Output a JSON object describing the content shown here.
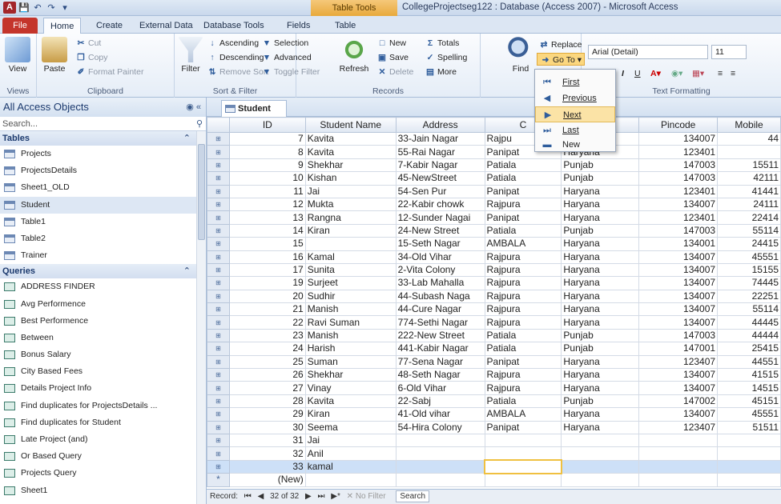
{
  "window": {
    "title": "CollegeProjectseg122 : Database (Access 2007) - Microsoft Access",
    "context_tab": "Table Tools",
    "app_icon": "A"
  },
  "tabs": [
    "File",
    "Home",
    "Create",
    "External Data",
    "Database Tools",
    "Fields",
    "Table"
  ],
  "ribbon": {
    "views": {
      "button": "View",
      "label": "Views"
    },
    "clipboard": {
      "paste": "Paste",
      "cut": "Cut",
      "copy": "Copy",
      "format_painter": "Format Painter",
      "label": "Clipboard"
    },
    "sort_filter": {
      "filter": "Filter",
      "ascending": "Ascending",
      "descending": "Descending",
      "remove_sort": "Remove Sort",
      "selection": "Selection",
      "advanced": "Advanced",
      "toggle_filter": "Toggle Filter",
      "label": "Sort & Filter"
    },
    "records": {
      "refresh": "Refresh",
      "refresh_sub": "All",
      "new": "New",
      "save": "Save",
      "delete": "Delete",
      "totals": "Totals",
      "spelling": "Spelling",
      "more": "More",
      "label": "Records"
    },
    "find": {
      "find": "Find",
      "replace": "Replace",
      "goto": "Go To"
    },
    "text_formatting": {
      "font": "Arial (Detail)",
      "size": "11",
      "label": "Text Formatting"
    }
  },
  "goto_menu": [
    {
      "label": "First",
      "icon": "first-record-icon"
    },
    {
      "label": "Previous",
      "icon": "previous-record-icon"
    },
    {
      "label": "Next",
      "icon": "next-record-icon"
    },
    {
      "label": "Last",
      "icon": "last-record-icon"
    },
    {
      "label": "New",
      "icon": "new-record-icon"
    }
  ],
  "nav_pane": {
    "title": "All Access Objects",
    "search_placeholder": "Search...",
    "tables_label": "Tables",
    "tables": [
      "Projects",
      "ProjectsDetails",
      "Sheet1_OLD",
      "Student",
      "Table1",
      "Table2",
      "Trainer"
    ],
    "queries_label": "Queries",
    "queries": [
      "ADDRESS FINDER",
      "Avg Performence",
      "Best Performence",
      "Between",
      "Bonus Salary",
      "City Based Fees",
      "Details Project Info",
      "Find duplicates for ProjectsDetails ...",
      "Find duplicates for Student",
      "Late Project (and)",
      "Or Based Query",
      "Projects Query",
      "Sheet1"
    ]
  },
  "document": {
    "tab": "Student",
    "columns": [
      "ID",
      "Student Name",
      "Address",
      "City",
      "State",
      "Pincode",
      "Mobile"
    ],
    "columns_visible": [
      "ID",
      "Student Name",
      "Address",
      "C",
      "te",
      "Pincode",
      "Mobile"
    ],
    "rows": [
      [
        "7",
        "Kavita",
        "33-Jain Nagar",
        "Rajpu",
        "na",
        "134007",
        "44"
      ],
      [
        "8",
        "Kavita",
        "55-Rai Nagar",
        "Panipat",
        "Haryana",
        "123401",
        ""
      ],
      [
        "9",
        "Shekhar",
        "7-Kabir Nagar",
        "Patiala",
        "Punjab",
        "147003",
        "15511"
      ],
      [
        "10",
        "Kishan",
        "45-NewStreet",
        "Patiala",
        "Punjab",
        "147003",
        "42111"
      ],
      [
        "11",
        "Jai",
        "54-Sen Pur",
        "Panipat",
        "Haryana",
        "123401",
        "41441"
      ],
      [
        "12",
        "Mukta",
        "22-Kabir chowk",
        "Rajpura",
        "Haryana",
        "134007",
        "24111"
      ],
      [
        "13",
        "Rangna",
        "12-Sunder Nagai",
        "Panipat",
        "Haryana",
        "123401",
        "22414"
      ],
      [
        "14",
        "Kiran",
        "24-New Street",
        "Patiala",
        "Punjab",
        "147003",
        "55114"
      ],
      [
        "15",
        "",
        "15-Seth Nagar",
        "AMBALA",
        "Haryana",
        "134001",
        "24415"
      ],
      [
        "16",
        "Kamal",
        "34-Old Vihar",
        "Rajpura",
        "Haryana",
        "134007",
        "45551"
      ],
      [
        "17",
        "Sunita",
        "2-Vita Colony",
        "Rajpura",
        "Haryana",
        "134007",
        "15155"
      ],
      [
        "19",
        "Surjeet",
        "33-Lab Mahalla",
        "Rajpura",
        "Haryana",
        "134007",
        "74445"
      ],
      [
        "20",
        "Sudhir",
        "44-Subash Naga",
        "Rajpura",
        "Haryana",
        "134007",
        "22251"
      ],
      [
        "21",
        "Manish",
        "44-Cure Nagar",
        "Rajpura",
        "Haryana",
        "134007",
        "55114"
      ],
      [
        "22",
        "Ravi Suman",
        "774-Sethi Nagar",
        "Rajpura",
        "Haryana",
        "134007",
        "44445"
      ],
      [
        "23",
        "Manish",
        "222-New Street",
        "Patiala",
        "Punjab",
        "147003",
        "44444"
      ],
      [
        "24",
        "Harish",
        "441-Kabir Nagar",
        "Patiala",
        "Punjab",
        "147001",
        "25415"
      ],
      [
        "25",
        "Suman",
        "77-Sena Nagar",
        "Panipat",
        "Haryana",
        "123407",
        "44551"
      ],
      [
        "26",
        "Shekhar",
        "48-Seth Nagar",
        "Rajpura",
        "Haryana",
        "134007",
        "41515"
      ],
      [
        "27",
        "Vinay",
        "6-Old Vihar",
        "Rajpura",
        "Haryana",
        "134007",
        "14515"
      ],
      [
        "28",
        "Kavita",
        "22-Sabj",
        "Patiala",
        "Punjab",
        "147002",
        "45151"
      ],
      [
        "29",
        "Kiran",
        "41-Old vihar",
        "AMBALA",
        "Haryana",
        "134007",
        "45551"
      ],
      [
        "30",
        "Seema",
        "54-Hira Colony",
        "Panipat",
        "Haryana",
        "123407",
        "51511"
      ],
      [
        "31",
        "Jai",
        "",
        "",
        "",
        "",
        ""
      ],
      [
        "32",
        "Anil",
        "",
        "",
        "",
        "",
        ""
      ],
      [
        "33",
        "kamal",
        "",
        "",
        "",
        "",
        ""
      ]
    ],
    "new_row": "(New)",
    "new_marker": "*"
  },
  "record_nav": {
    "label": "Record:",
    "position": "32 of 32",
    "filter": "No Filter",
    "search": "Search"
  }
}
